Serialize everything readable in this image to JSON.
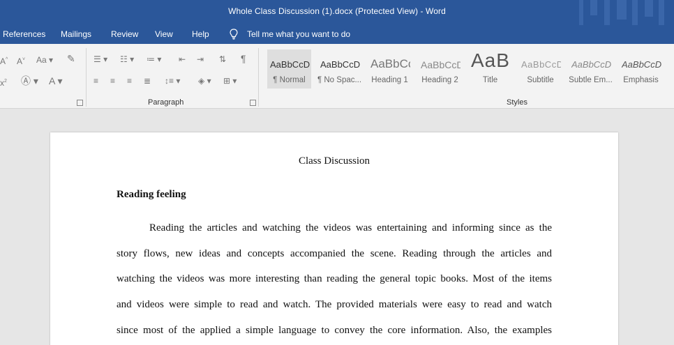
{
  "window": {
    "title": "Whole Class Discussion (1).docx (Protected View)  -  Word"
  },
  "menu": {
    "tabs": [
      "References",
      "Mailings",
      "Review",
      "View",
      "Help"
    ],
    "tell_me": "Tell me what you want to do"
  },
  "ribbon": {
    "paragraph_label": "Paragraph",
    "styles_label": "Styles",
    "styles": [
      {
        "preview": "AaBbCcDc",
        "name": "¶ Normal"
      },
      {
        "preview": "AaBbCcDc",
        "name": "¶ No Spac..."
      },
      {
        "preview": "AaBbCc",
        "name": "Heading 1"
      },
      {
        "preview": "AaBbCcD",
        "name": "Heading 2"
      },
      {
        "preview": "AaB",
        "name": "Title"
      },
      {
        "preview": "AaBbCcD",
        "name": "Subtitle"
      },
      {
        "preview": "AaBbCcDc",
        "name": "Subtle Em..."
      },
      {
        "preview": "AaBbCcDc",
        "name": "Emphasis"
      }
    ]
  },
  "document": {
    "title": "Class Discussion",
    "heading": "Reading feeling",
    "lines": [
      "Reading the articles and watching the videos was entertaining and informing since as the",
      "story flows, new ideas and concepts accompanied the scene. Reading through the articles and",
      "watching the videos was more interesting than reading the general topic books. Most of the items",
      "and videos were simple to read and watch. The provided materials were easy to read and watch",
      "since most of the applied a simple language to convey the core information. Also, the examples"
    ]
  },
  "colors": {
    "word_blue": "#2b579a",
    "ribbon_bg": "#f3f3f3",
    "canvas_bg": "#e6e6e6"
  }
}
